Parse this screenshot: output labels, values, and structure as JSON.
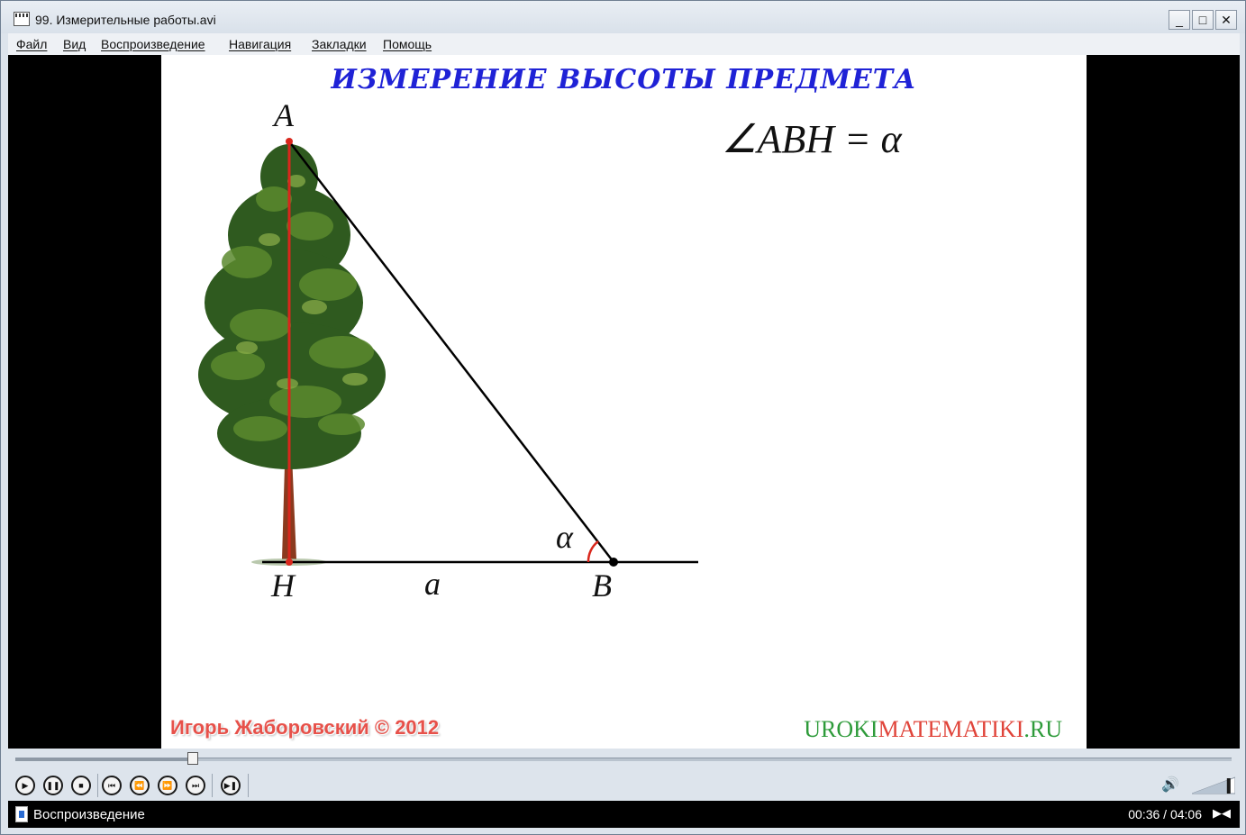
{
  "window": {
    "title": "99. Измерительные работы.avi",
    "minimize_glyph": "_",
    "maximize_glyph": "□",
    "close_glyph": "✕"
  },
  "menu": {
    "items": [
      "Файл",
      "Вид",
      "Воспроизведение",
      "Навигация",
      "Закладки",
      "Помощь"
    ]
  },
  "slide": {
    "title": "ИЗМЕРЕНИЕ ВЫСОТЫ ПРЕДМЕТА",
    "formula": "∠ABH = α",
    "labels": {
      "A": "A",
      "H": "H",
      "B": "B",
      "a": "a",
      "alpha": "α"
    },
    "author": "Игорь Жаборовский © 2012",
    "site_prefix": "UROKI",
    "site_middle": "MATEMATIKI",
    "site_suffix": ".RU"
  },
  "playback": {
    "progress": 0.146,
    "volume": 0.85
  },
  "controls": {
    "icons": [
      "play-icon",
      "pause-icon",
      "stop-icon",
      "previous-icon",
      "rewind-icon",
      "fast-forward-icon",
      "next-icon",
      "frame-step-icon",
      "volume-icon"
    ]
  },
  "status": {
    "text": "Воспроизведение",
    "time": "00:36 / 04:06"
  },
  "colors": {
    "title_blue": "#1f22d6",
    "author_red": "#e7514a",
    "site_green": "#2e9b3a",
    "height_line_red": "#d9271c"
  }
}
